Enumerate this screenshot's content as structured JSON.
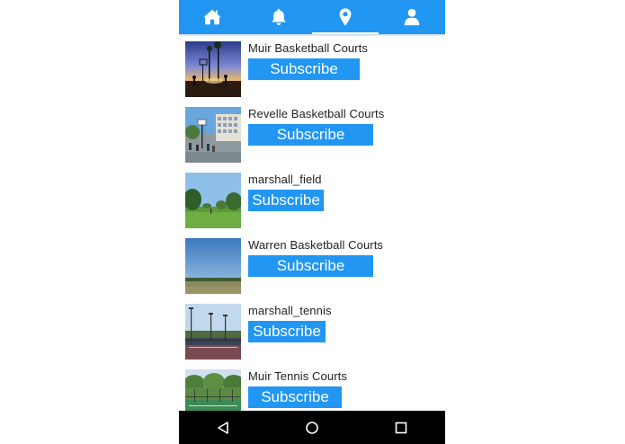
{
  "tabs": [
    {
      "icon": "home-icon",
      "active": false
    },
    {
      "icon": "bell-icon",
      "active": false
    },
    {
      "icon": "map-pin-icon",
      "active": true
    },
    {
      "icon": "user-icon",
      "active": false
    }
  ],
  "items": [
    {
      "title": "Muir Basketball Courts",
      "button": "Subscribe",
      "image": "basketball-court-sunset-image"
    },
    {
      "title": "Revelle Basketball Courts",
      "button": "Subscribe",
      "image": "campus-court-buildings-image"
    },
    {
      "title": "marshall_field",
      "button": "Subscribe",
      "image": "grass-field-trees-image"
    },
    {
      "title": "Warren Basketball Courts",
      "button": "Subscribe",
      "image": "open-field-sky-image"
    },
    {
      "title": "marshall_tennis",
      "button": "Subscribe",
      "image": "tennis-courts-lights-image"
    },
    {
      "title": "Muir Tennis Courts",
      "button": "Subscribe",
      "image": "tennis-court-fence-image"
    }
  ],
  "navbar": {
    "back": "back-icon",
    "home": "home-circle-icon",
    "recents": "recents-square-icon"
  },
  "colors": {
    "accent": "#2196f3",
    "navbar": "#000000"
  }
}
